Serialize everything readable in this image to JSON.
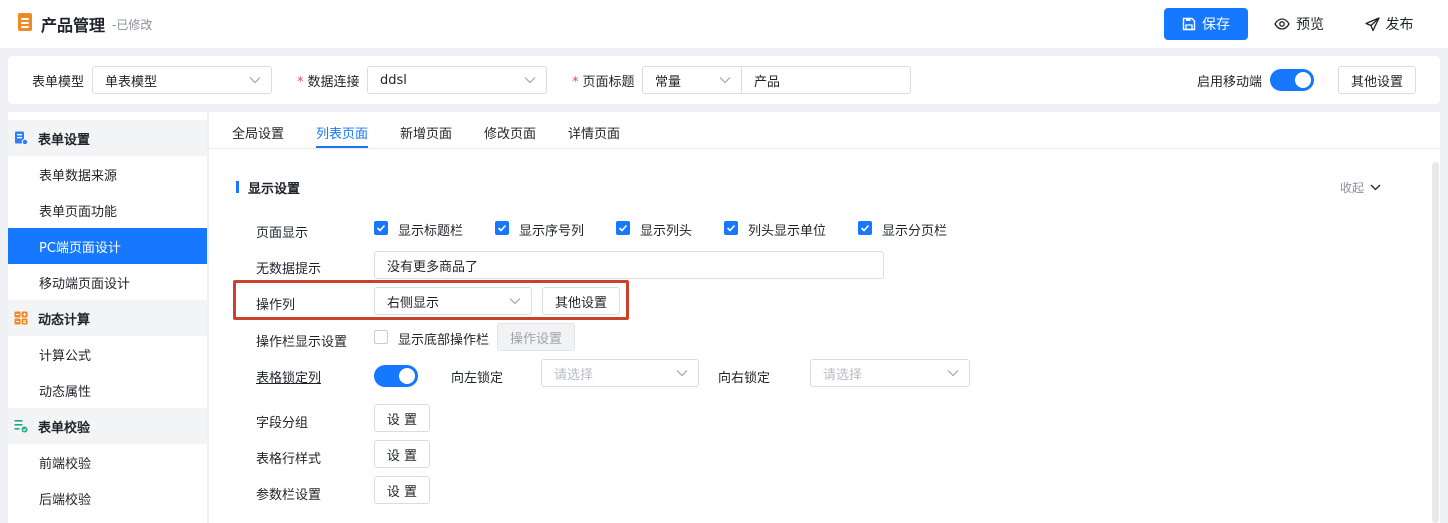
{
  "header": {
    "title": "产品管理",
    "status": "-已修改",
    "save_label": "保存",
    "preview_label": "预览",
    "publish_label": "发布"
  },
  "config": {
    "form_model_label": "表单模型",
    "form_model_value": "单表模型",
    "data_conn_label": "数据连接",
    "data_conn_value": "ddsl",
    "page_title_label": "页面标题",
    "page_title_type": "常量",
    "page_title_value": "产品",
    "mobile_label": "启用移动端",
    "mobile_enabled": true,
    "other_settings": "其他设置"
  },
  "sidebar": {
    "groups": [
      {
        "label": "表单设置",
        "items": [
          "表单数据来源",
          "表单页面功能",
          "PC端页面设计",
          "移动端页面设计"
        ]
      },
      {
        "label": "动态计算",
        "items": [
          "计算公式",
          "动态属性"
        ]
      },
      {
        "label": "表单校验",
        "items": [
          "前端校验",
          "后端校验"
        ]
      }
    ],
    "active_item": "PC端页面设计"
  },
  "tabs": [
    "全局设置",
    "列表页面",
    "新增页面",
    "修改页面",
    "详情页面"
  ],
  "active_tab": "列表页面",
  "section": {
    "title": "显示设置",
    "collapse_label": "收起"
  },
  "form": {
    "page_display_label": "页面显示",
    "page_display_options": [
      {
        "label": "显示标题栏",
        "checked": true
      },
      {
        "label": "显示序号列",
        "checked": true
      },
      {
        "label": "显示列头",
        "checked": true
      },
      {
        "label": "列头显示单位",
        "checked": true
      },
      {
        "label": "显示分页栏",
        "checked": true
      }
    ],
    "no_data_label": "无数据提示",
    "no_data_value": "没有更多商品了",
    "action_col_label": "操作列",
    "action_col_value": "右侧显示",
    "action_col_btn": "其他设置",
    "action_bar_label": "操作栏显示设置",
    "action_bar_checkbox": "显示底部操作栏",
    "action_bar_checked": false,
    "action_bar_btn": "操作设置",
    "lock_col_label": "表格锁定列",
    "lock_col_enabled": true,
    "lock_left_label": "向左锁定",
    "lock_left_placeholder": "请选择",
    "lock_right_label": "向右锁定",
    "lock_right_placeholder": "请选择",
    "field_group_label": "字段分组",
    "row_style_label": "表格行样式",
    "param_bar_label": "参数栏设置",
    "set_btn": "设 置"
  },
  "colors": {
    "primary": "#1677ff",
    "highlight_border": "#c8432b",
    "app_icon": "#f08a24"
  }
}
